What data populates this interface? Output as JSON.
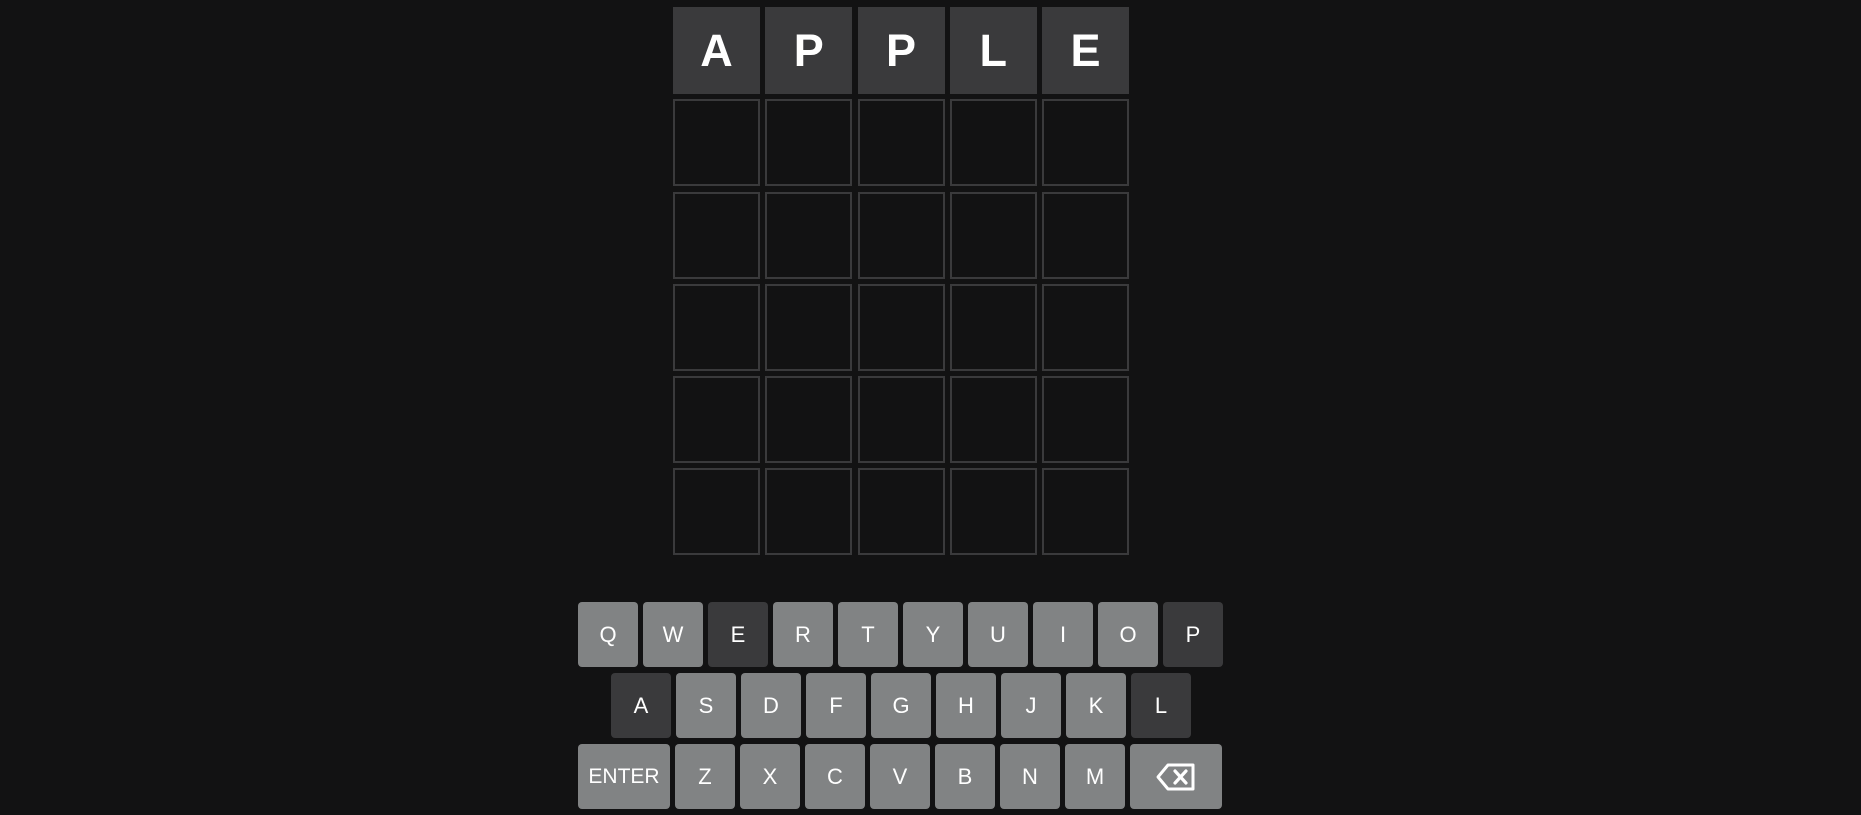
{
  "board": {
    "rows": [
      [
        "A",
        "P",
        "P",
        "L",
        "E"
      ],
      [
        "",
        "",
        "",
        "",
        ""
      ],
      [
        "",
        "",
        "",
        "",
        ""
      ],
      [
        "",
        "",
        "",
        "",
        ""
      ],
      [
        "",
        "",
        "",
        "",
        ""
      ],
      [
        "",
        "",
        "",
        "",
        ""
      ]
    ]
  },
  "keyboard": {
    "row1": [
      "Q",
      "W",
      "E",
      "R",
      "T",
      "Y",
      "U",
      "I",
      "O",
      "P"
    ],
    "row2": [
      "A",
      "S",
      "D",
      "F",
      "G",
      "H",
      "J",
      "K",
      "L"
    ],
    "row3": [
      "ENTER",
      "Z",
      "X",
      "C",
      "V",
      "B",
      "N",
      "M"
    ],
    "absent_keys": [
      "E",
      "P",
      "A",
      "L"
    ],
    "backspace_icon": "backspace-icon"
  },
  "colors": {
    "background": "#121213",
    "tile_border": "#3a3a3c",
    "tile_filled": "#3a3a3c",
    "key_default": "#818384",
    "key_absent": "#3a3a3c"
  }
}
